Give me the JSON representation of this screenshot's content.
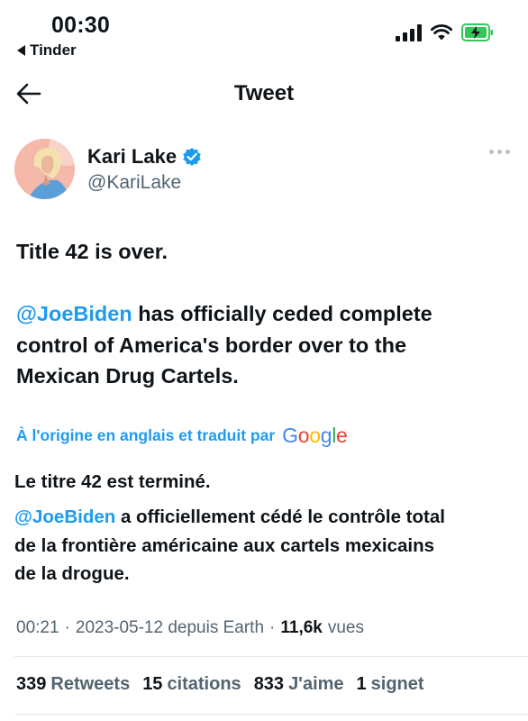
{
  "status_bar": {
    "time": "00:30",
    "back_app": "Tinder"
  },
  "header": {
    "title": "Tweet"
  },
  "author": {
    "name": "Kari Lake",
    "handle": "@KariLake"
  },
  "tweet": {
    "line1": "Title 42 is over.",
    "mention": "@JoeBiden",
    "line2_rest": " has officially ceded complete",
    "line3": "control of America's border over to the",
    "line4": "Mexican Drug Cartels."
  },
  "translation": {
    "label": "À l'origine en anglais et traduit par",
    "provider": "Google",
    "line1": "Le titre 42 est terminé.",
    "mention": "@JoeBiden",
    "line2_rest": " a officiellement cédé le contrôle total",
    "line3": "de la frontière américaine aux cartels mexicains",
    "line4": "de la drogue."
  },
  "meta": {
    "time": "00:21",
    "date_source": "2023-05-12 depuis Earth",
    "views_count": "11,6k",
    "views_label": "vues",
    "separator": "·"
  },
  "stats": {
    "retweets_count": "339",
    "retweets_label": "Retweets",
    "quotes_count": "15",
    "quotes_label": "citations",
    "likes_count": "833",
    "likes_label": "J'aime",
    "bookmarks_count": "1",
    "bookmarks_label": "signet"
  },
  "colors": {
    "link": "#1d9bf0",
    "verified": "#1d9bf0",
    "battery": "#34c759",
    "muted": "#536471"
  }
}
